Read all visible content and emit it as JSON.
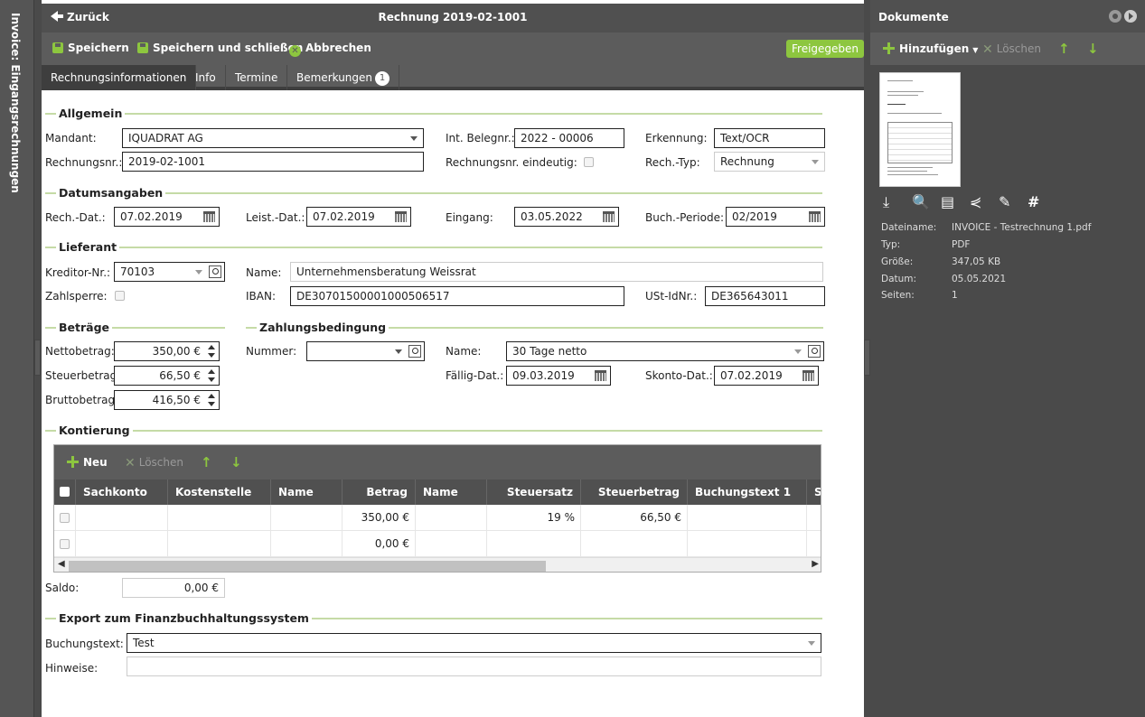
{
  "sidebar": {
    "module_title": "Invoice: Eingangsrechnungen"
  },
  "header": {
    "back_label": "Zurück",
    "title": "Rechnung 2019-02-1001"
  },
  "toolbar": {
    "save": "Speichern",
    "save_close": "Speichern und schließen",
    "cancel": "Abbrechen",
    "release": "Freigegeben"
  },
  "tabs": [
    {
      "label": "Rechnungsinformationen"
    },
    {
      "label": "Info"
    },
    {
      "label": "Termine"
    },
    {
      "label": "Bemerkungen",
      "badge": "1"
    }
  ],
  "allgemein": {
    "title": "Allgemein",
    "mandant_label": "Mandant:",
    "mandant": "IQUADRAT AG",
    "belegnr_label": "Int. Belegnr.:",
    "belegnr": "2022 - 00006",
    "erkennung_label": "Erkennung:",
    "erkennung": "Text/OCR",
    "rechnungsnr_label": "Rechnungsnr.:",
    "rechnungsnr": "2019-02-1001",
    "eindeutig_label": "Rechnungsnr. eindeutig:",
    "rechtyp_label": "Rech.-Typ:",
    "rechtyp": "Rechnung"
  },
  "datum": {
    "title": "Datumsangaben",
    "rechdat_label": "Rech.-Dat.:",
    "rechdat": "07.02.2019",
    "leistdat_label": "Leist.-Dat.:",
    "leistdat": "07.02.2019",
    "eingang_label": "Eingang:",
    "eingang": "03.05.2022",
    "buchperiode_label": "Buch.-Periode:",
    "buchperiode": "02/2019"
  },
  "lieferant": {
    "title": "Lieferant",
    "kreditor_label": "Kreditor-Nr.:",
    "kreditor": "70103",
    "name_label": "Name:",
    "name": "Unternehmensberatung Weissrat",
    "zahlsperre_label": "Zahlsperre:",
    "iban_label": "IBAN:",
    "iban": "DE30701500001000506517",
    "ustid_label": "USt-IdNr.:",
    "ustid": "DE365643011"
  },
  "betraege": {
    "title": "Beträge",
    "netto_label": "Nettobetrag:",
    "netto": "350,00 €",
    "steuer_label": "Steuerbetrag:",
    "steuer": "66,50 €",
    "brutto_label": "Bruttobetrag:",
    "brutto": "416,50 €"
  },
  "zahlung": {
    "title": "Zahlungsbedingung",
    "nummer_label": "Nummer:",
    "nummer": "",
    "name_label": "Name:",
    "name": "30 Tage netto",
    "faellig_label": "Fällig-Dat.:",
    "faellig": "09.03.2019",
    "skonto_label": "Skonto-Dat.:",
    "skonto": "07.02.2019"
  },
  "kontierung": {
    "title": "Kontierung",
    "new_label": "Neu",
    "delete_label": "Löschen",
    "columns": [
      "Sachkonto",
      "Kostenstelle",
      "Name",
      "Betrag",
      "Name",
      "Steuersatz",
      "Steuerbetrag",
      "Buchungstext 1",
      "S"
    ],
    "rows": [
      [
        "",
        "",
        "",
        "350,00 €",
        "",
        "19 %",
        "66,50 €",
        ""
      ],
      [
        "",
        "",
        "",
        "0,00 €",
        "",
        "",
        "",
        ""
      ]
    ],
    "saldo_label": "Saldo:",
    "saldo": "0,00 €"
  },
  "export": {
    "title": "Export zum Finanzbuchhaltungssystem",
    "buchungstext_label": "Buchungstext:",
    "buchungstext": "Test",
    "hinweise_label": "Hinweise:",
    "hinweise": ""
  },
  "documents": {
    "title": "Dokumente",
    "add_label": "Hinzufügen",
    "delete_label": "Löschen",
    "meta": [
      {
        "label": "Dateiname:",
        "value": "INVOICE - Testrechnung 1.pdf"
      },
      {
        "label": "Typ:",
        "value": "PDF"
      },
      {
        "label": "Größe:",
        "value": "347,05 KB"
      },
      {
        "label": "Datum:",
        "value": "05.05.2021"
      },
      {
        "label": "Seiten:",
        "value": "1"
      }
    ]
  },
  "colors": {
    "accent": "#8dc63f",
    "header": "#505050",
    "toolbar": "#5c5c5c"
  }
}
